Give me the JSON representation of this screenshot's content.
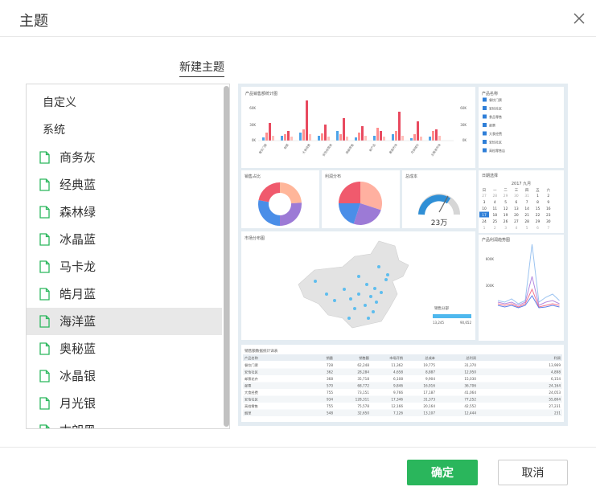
{
  "dialog": {
    "title": "主题"
  },
  "new_theme_label": "新建主题",
  "theme_list": {
    "categories": [
      "自定义",
      "系统"
    ],
    "items": [
      {
        "label": "商务灰"
      },
      {
        "label": "经典蓝"
      },
      {
        "label": "森林绿"
      },
      {
        "label": "冰晶蓝"
      },
      {
        "label": "马卡龙"
      },
      {
        "label": "皓月蓝"
      },
      {
        "label": "海洋蓝",
        "selected": true
      },
      {
        "label": "奥秘蓝"
      },
      {
        "label": "冰晶银"
      },
      {
        "label": "月光银"
      },
      {
        "label": "古朗黑"
      }
    ]
  },
  "buttons": {
    "confirm": "确定",
    "cancel": "取消"
  },
  "colors": {
    "accent": "#2ab65c",
    "selected_bg": "#e8e8e8",
    "doc_icon": "#2ab65c"
  },
  "icons": {
    "close": "close-icon",
    "theme_item": "document-icon"
  },
  "preview": {
    "bar_panel": {
      "title": "产品销售额统计图",
      "y_ticks": [
        "60K",
        "30K",
        "0K"
      ],
      "y2_ticks": [
        "60K",
        "30K",
        "0K"
      ],
      "categories": [
        "餐饮门票",
        "邮票",
        "大食经费",
        "安怡经营类",
        "旗舰零售",
        "新产品",
        "果蔬市场",
        "月饼城市",
        "五粮液市场"
      ]
    },
    "filter_panel": {
      "title": "产品名称",
      "options": [
        "餐饮门票",
        "安怡社区",
        "食品零售",
        "邮票",
        "大食经费",
        "安怡社区",
        "高档零售店"
      ]
    },
    "pie1": {
      "title": "销售占比"
    },
    "pie2": {
      "title": "利润分布"
    },
    "gauge": {
      "title": "总成本",
      "value": "23万"
    },
    "calendar": {
      "title": "日期选择",
      "month": "2017 九月",
      "weekdays": [
        "日",
        "一",
        "二",
        "三",
        "四",
        "五",
        "六"
      ],
      "rows": [
        [
          "27",
          "28",
          "29",
          "30",
          "31",
          "1",
          "2"
        ],
        [
          "3",
          "4",
          "5",
          "6",
          "7",
          "8",
          "9"
        ],
        [
          "10",
          "11",
          "12",
          "13",
          "14",
          "15",
          "16"
        ],
        [
          "17",
          "18",
          "19",
          "20",
          "21",
          "22",
          "23"
        ],
        [
          "24",
          "25",
          "26",
          "27",
          "28",
          "29",
          "30"
        ],
        [
          "1",
          "2",
          "3",
          "4",
          "5",
          "6",
          "7"
        ]
      ],
      "selected_row": 3,
      "selected_col": 0
    },
    "map_panel": {
      "title": "市场分布图",
      "legend_title": "销售分部",
      "legend_min": "13,245",
      "legend_max": "90,652"
    },
    "line_panel": {
      "title": "产品利润趋势图",
      "y_ticks": [
        "600K",
        "300K"
      ]
    },
    "table": {
      "title": "销售额数据统计详表",
      "headers": [
        "产品名称",
        "销量",
        "销售额",
        "市场开销",
        "总成本",
        "总利润",
        "利润"
      ],
      "rows": [
        [
          "餐饮门票",
          "728",
          "62,248",
          "11,362",
          "19,775",
          "31,370",
          "13,969"
        ],
        [
          "安怡社区",
          "362",
          "28,284",
          "4,658",
          "8,887",
          "12,950",
          "4,898"
        ],
        [
          "邮票花卉",
          "368",
          "35,718",
          "6,108",
          "9,904",
          "15,030",
          "6,154"
        ],
        [
          "邮票",
          "570",
          "68,772",
          "9,846",
          "16,916",
          "36,706",
          "24,164"
        ],
        [
          "大食经费",
          "755",
          "73,151",
          "9,766",
          "17,187",
          "41,064",
          "24,053"
        ],
        [
          "安怡社区",
          "934",
          "128,311",
          "17,346",
          "31,373",
          "77,252",
          "55,804"
        ],
        [
          "高档零售",
          "755",
          "75,578",
          "12,166",
          "20,164",
          "42,552",
          "27,231"
        ],
        [
          "烟草",
          "548",
          "32,650",
          "7,126",
          "13,107",
          "12,444",
          "231"
        ]
      ]
    }
  }
}
